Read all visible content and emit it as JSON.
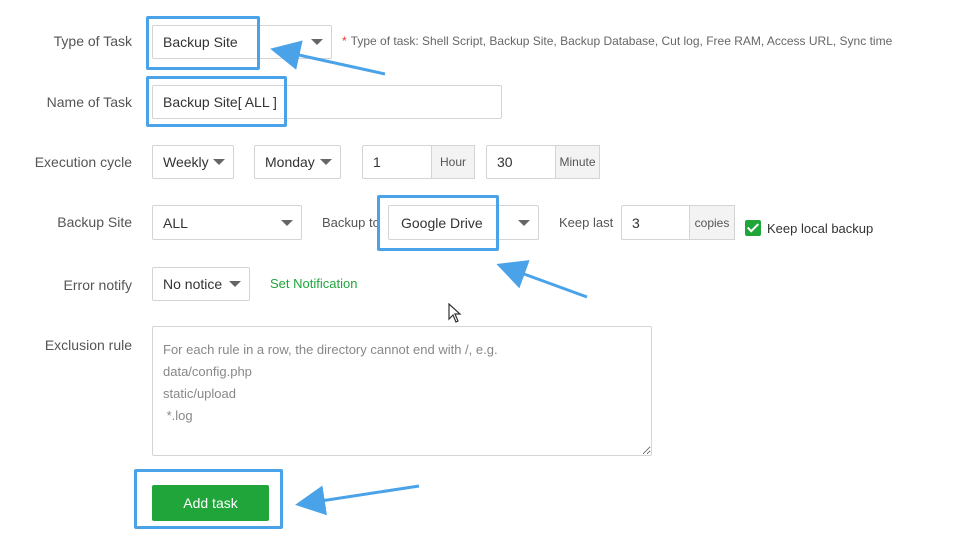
{
  "form": {
    "type_label": "Type of Task",
    "type_value": "Backup Site",
    "type_hint": "Type of task: Shell Script, Backup Site, Backup Database, Cut log, Free RAM, Access URL, Sync time",
    "name_label": "Name of Task",
    "name_value": "Backup Site[ ALL ]",
    "cycle_label": "Execution cycle",
    "cycle_period": "Weekly",
    "cycle_day": "Monday",
    "cycle_hour": "1",
    "hour_addon": "Hour",
    "cycle_minute": "30",
    "minute_addon": "Minute",
    "backup_site_label": "Backup Site",
    "backup_site_value": "ALL",
    "backup_to_label": "Backup to",
    "backup_to_value": "Google Drive",
    "keep_last_label": "Keep last",
    "keep_last_value": "3",
    "copies_addon": "copies",
    "keep_local_label": "Keep local backup",
    "keep_local_checked": true,
    "error_label": "Error notify",
    "error_value": "No notice",
    "set_notification": "Set Notification",
    "exclusion_label": "Exclusion rule",
    "exclusion_placeholder": "For each rule in a row, the directory cannot end with /, e.g.\ndata/config.php\nstatic/upload\n *.log",
    "add_button": "Add task"
  },
  "colors": {
    "accent_green": "#20a53a",
    "highlight_blue": "#4aa3e8",
    "required_star": "#ee3333"
  }
}
